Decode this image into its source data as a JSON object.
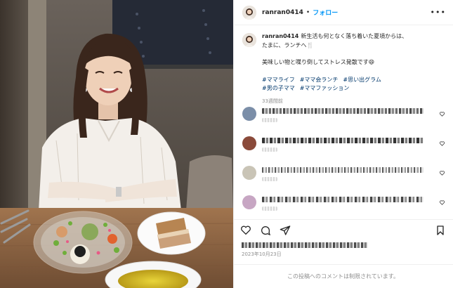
{
  "post": {
    "username": "ranran0414",
    "separator": "•",
    "follow_label": "フォロー",
    "more_icon": "•••",
    "caption": {
      "username": "ranran0414",
      "line1": "新生活も何となく落ち着いた夏頃からは、",
      "line2": "たまに、ランチへ",
      "line2_emoji": "🍴",
      "line3": "美味しい物と喋り倒してストレス発散です",
      "line3_emoji": "😄",
      "hashtags": [
        "#ママライフ",
        "#ママ会ランチ",
        "#思い出グラム",
        "#男の子ママ",
        "#ママファッション"
      ],
      "time_ago": "33週間前"
    },
    "comments": [
      {
        "avatar_color": "#7b8ea8",
        "blur": "pix1"
      },
      {
        "avatar_color": "#8a4a3a",
        "blur": "pix2"
      },
      {
        "avatar_color": "#c9c4b6",
        "blur": "pix3"
      },
      {
        "avatar_color": "#c7a6c3",
        "blur": "pix4"
      }
    ],
    "date": "2023年10月23日",
    "comments_disabled": "この投稿へのコメントは制限されています。"
  },
  "colors": {
    "accent": "#0095f6",
    "hashtag": "#00376b",
    "muted": "#8e8e8e"
  },
  "icons": [
    "more-icon",
    "heart-icon",
    "comment-icon",
    "share-icon",
    "bookmark-icon"
  ]
}
